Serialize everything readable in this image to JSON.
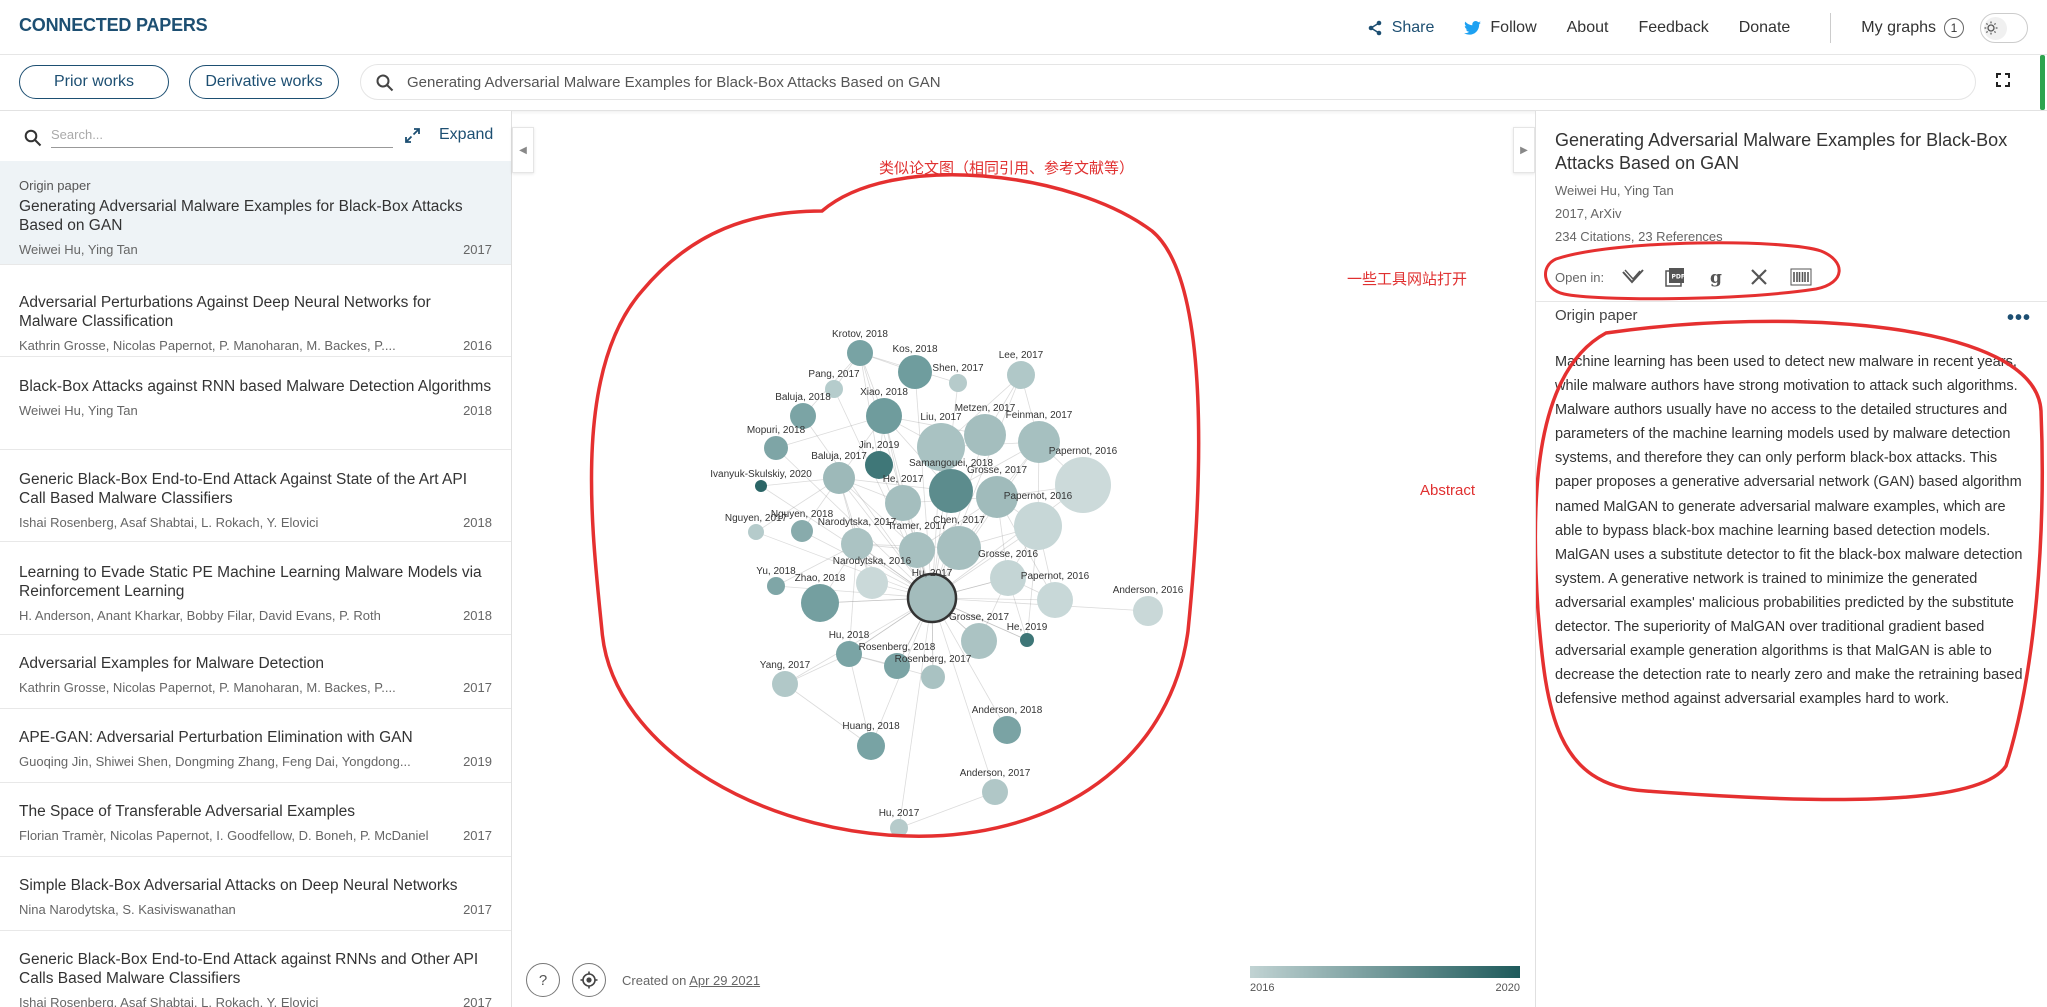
{
  "header": {
    "logo": "CONNECTED PAPERS",
    "share": "Share",
    "follow": "Follow",
    "about": "About",
    "feedback": "Feedback",
    "donate": "Donate",
    "my_graphs": "My graphs",
    "my_graphs_count": "1"
  },
  "toolbar": {
    "prior_works": "Prior works",
    "derivative_works": "Derivative works",
    "search_value": "Generating Adversarial Malware Examples for Black-Box Attacks Based on GAN"
  },
  "left": {
    "search_placeholder": "Search...",
    "expand": "Expand",
    "origin_label": "Origin paper",
    "papers": [
      {
        "title": "Generating Adversarial Malware Examples for Black-Box Attacks Based on GAN",
        "authors": "Weiwei Hu, Ying Tan",
        "year": "2017"
      },
      {
        "title": "Adversarial Perturbations Against Deep Neural Networks for Malware Classification",
        "authors": "Kathrin Grosse, Nicolas Papernot, P. Manoharan, M. Backes, P....",
        "year": "2016"
      },
      {
        "title": "Black-Box Attacks against RNN based Malware Detection Algorithms",
        "authors": "Weiwei Hu, Ying Tan",
        "year": "2018"
      },
      {
        "title": "Generic Black-Box End-to-End Attack Against State of the Art API Call Based Malware Classifiers",
        "authors": "Ishai Rosenberg, Asaf Shabtai, L. Rokach, Y. Elovici",
        "year": "2018"
      },
      {
        "title": "Learning to Evade Static PE Machine Learning Malware Models via Reinforcement Learning",
        "authors": "H. Anderson, Anant Kharkar, Bobby Filar, David Evans, P. Roth",
        "year": "2018"
      },
      {
        "title": "Adversarial Examples for Malware Detection",
        "authors": "Kathrin Grosse, Nicolas Papernot, P. Manoharan, M. Backes, P....",
        "year": "2017"
      },
      {
        "title": "APE-GAN: Adversarial Perturbation Elimination with GAN",
        "authors": "Guoqing Jin, Shiwei Shen, Dongming Zhang, Feng Dai, Yongdong...",
        "year": "2019"
      },
      {
        "title": "The Space of Transferable Adversarial Examples",
        "authors": "Florian Tramèr, Nicolas Papernot, I. Goodfellow, D. Boneh, P. McDaniel",
        "year": "2017"
      },
      {
        "title": "Simple Black-Box Adversarial Attacks on Deep Neural Networks",
        "authors": "Nina Narodytska, S. Kasiviswanathan",
        "year": "2017"
      },
      {
        "title": "Generic Black-Box End-to-End Attack against RNNs and Other API Calls Based Malware Classifiers",
        "authors": "Ishai Rosenberg, Asaf Shabtai, L. Rokach, Y. Elovici",
        "year": "2017"
      }
    ]
  },
  "center": {
    "annotation_graph": "类似论文图（相同引用、参考文献等）",
    "annotation_tools": "一些工具网站打开",
    "annotation_abstract": "Abstract",
    "created_prefix": "Created on ",
    "created_date": "Apr 29 2021",
    "help": "?",
    "legend_start": "2016",
    "legend_end": "2020",
    "nodes": [
      {
        "label": "Krotov, 2018",
        "color": "#78a3a4"
      },
      {
        "label": "Kos, 2018",
        "color": "#6f9d9e"
      },
      {
        "label": "Shen, 2017",
        "color": "#b6cbcb"
      },
      {
        "label": "Lee, 2017",
        "color": "#b0c8c8"
      },
      {
        "label": "Pang, 2017",
        "color": "#b5cccc"
      },
      {
        "label": "Baluja, 2018",
        "color": "#7ba4a5"
      },
      {
        "label": "Xiao, 2018",
        "color": "#6f9c9d"
      },
      {
        "label": "Mopuri, 2018",
        "color": "#7ea5a6"
      },
      {
        "label": "Metzen, 2017",
        "color": "#a4bebe"
      },
      {
        "label": "Feinman, 2017",
        "color": "#a6c0c0"
      },
      {
        "label": "Liu, 2017",
        "color": "#a9c2c2"
      },
      {
        "label": "Jin, 2019",
        "color": "#3f7778"
      },
      {
        "label": "Baluja, 2017",
        "color": "#9db9b9"
      },
      {
        "label": "Ivanyuk-Skulskiy, 2020",
        "color": "#2b6566"
      },
      {
        "label": "Samangouei, 2018",
        "color": "#5c8c8d"
      },
      {
        "label": "Grosse, 2017",
        "color": "#a0bbbb"
      },
      {
        "label": "Papernot, 2016",
        "color": "#ccdada"
      },
      {
        "label": "He, 2017",
        "color": "#a4bebe"
      },
      {
        "label": "Papernot, 2016",
        "color": "#c7d7d7"
      },
      {
        "label": "Nguyen, 2017",
        "color": "#b5cbcb"
      },
      {
        "label": "Nguyen, 2018",
        "color": "#88abac"
      },
      {
        "label": "Narodytska, 2017",
        "color": "#abc3c3"
      },
      {
        "label": "Tramer, 2017",
        "color": "#a7c0c0"
      },
      {
        "label": "Chen, 2017",
        "color": "#a6bfbf"
      },
      {
        "label": "Grosse, 2016",
        "color": "#c4d5d5"
      },
      {
        "label": "Yu, 2018",
        "color": "#7fa6a7"
      },
      {
        "label": "Narodytska, 2016",
        "color": "#cad9d9"
      },
      {
        "label": "Hu, 2017",
        "color": "#a3bcbc"
      },
      {
        "label": "Zhao, 2018",
        "color": "#749fa0"
      },
      {
        "label": "Papernot, 2016",
        "color": "#c8d8d8"
      },
      {
        "label": "Anderson, 2016",
        "color": "#c9d8d8"
      },
      {
        "label": "Grosse, 2017",
        "color": "#abc3c3"
      },
      {
        "label": "He, 2019",
        "color": "#3e7677"
      },
      {
        "label": "Hu, 2018",
        "color": "#7aa4a5"
      },
      {
        "label": "Rosenberg, 2018",
        "color": "#7ba4a5"
      },
      {
        "label": "Rosenberg, 2017",
        "color": "#a9c2c2"
      },
      {
        "label": "Yang, 2017",
        "color": "#b1c8c8"
      },
      {
        "label": "Anderson, 2018",
        "color": "#7aa3a4"
      },
      {
        "label": "Huang, 2018",
        "color": "#78a3a4"
      },
      {
        "label": "Anderson, 2017",
        "color": "#b0c7c7"
      },
      {
        "label": "Hu, 2017",
        "color": "#b6cbcb"
      }
    ]
  },
  "right": {
    "title": "Generating Adversarial Malware Examples for Black-Box Attacks Based on GAN",
    "authors": "Weiwei Hu, Ying Tan",
    "venue": "2017, ArXiv",
    "citations": "234 Citations, 23 References",
    "open_in": "Open in:",
    "origin_label": "Origin paper",
    "abstract": "Machine learning has been used to detect new malware in recent years, while malware authors have strong motivation to attack such algorithms. Malware authors usually have no access to the detailed structures and parameters of the machine learning models used by malware detection systems, and therefore they can only perform black-box attacks. This paper proposes a generative adversarial network (GAN) based algorithm named MalGAN to generate adversarial malware examples, which are able to bypass black-box machine learning based detection models. MalGAN uses a substitute detector to fit the black-box malware detection system. A generative network is trained to minimize the generated adversarial examples' malicious probabilities predicted by the substitute detector. The superiority of MalGAN over traditional gradient based adversarial example generation algorithms is that MalGAN is able to decrease the detection rate to nearly zero and make the retraining based defensive method against adversarial examples hard to work."
  }
}
